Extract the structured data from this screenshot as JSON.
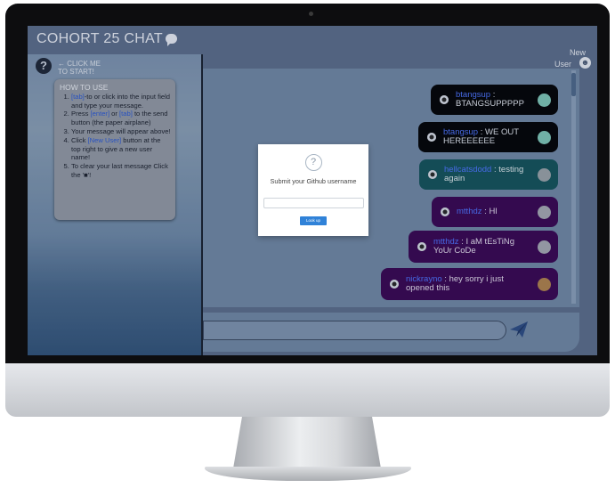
{
  "app": {
    "title": "COHORT 25 CHAT"
  },
  "header": {
    "new_user_label_line1": "New",
    "new_user_label_line2": "User"
  },
  "sidebar": {
    "click_me_line1": "← CLICK ME",
    "click_me_line2": "TO START!",
    "howto_title": "HOW TO USE",
    "steps": [
      {
        "pre": "",
        "key": "[tab]",
        "post": "-to or click into the input field and type your message."
      },
      {
        "pre": "Press ",
        "key": "[enter]",
        "mid": " or ",
        "key2": "[tab]",
        "post": " to the send button (the paper airplane)"
      },
      {
        "pre": "Your message will appear above!"
      },
      {
        "pre": "Click ",
        "key": "[New User]",
        "post": " button at the top right to give a new user name!"
      },
      {
        "pre": "To clear your last message Click the '",
        "post": "'!"
      }
    ]
  },
  "messages": [
    {
      "user": "btangsup",
      "text": "BTANGSUPPPPP",
      "style": "black",
      "avatar_color": "#7fc7b8"
    },
    {
      "user": "btangsup",
      "text": "WE OUT HEREEEEEE",
      "style": "black",
      "avatar_color": "#7fc7b8"
    },
    {
      "user": "hellcatsdodd",
      "text": "testing again",
      "style": "teal",
      "avatar_color": "#9aa3a9"
    },
    {
      "user": "mtthdz",
      "text": "HI",
      "style": "purple",
      "avatar_color": "#a5a9b3"
    },
    {
      "user": "mtthdz",
      "text": "I aM tEsTiNg YoUr CoDe",
      "style": "purple",
      "avatar_color": "#a5a9b3"
    },
    {
      "user": "nickrayno",
      "text": "hey sorry i just opened this",
      "style": "purple",
      "avatar_color": "#b0834f"
    }
  ],
  "modal": {
    "icon": "?",
    "title": "Submit your Github username",
    "input_value": "",
    "button_label": "Look up"
  },
  "composer": {
    "input_value": "",
    "send_icon": "paper-airplane-icon"
  },
  "colors": {
    "username": "#4f76ff",
    "message_black": "#050608",
    "message_teal": "#16555d",
    "message_purple": "#3b0a55",
    "modal_button": "#3082d8"
  }
}
